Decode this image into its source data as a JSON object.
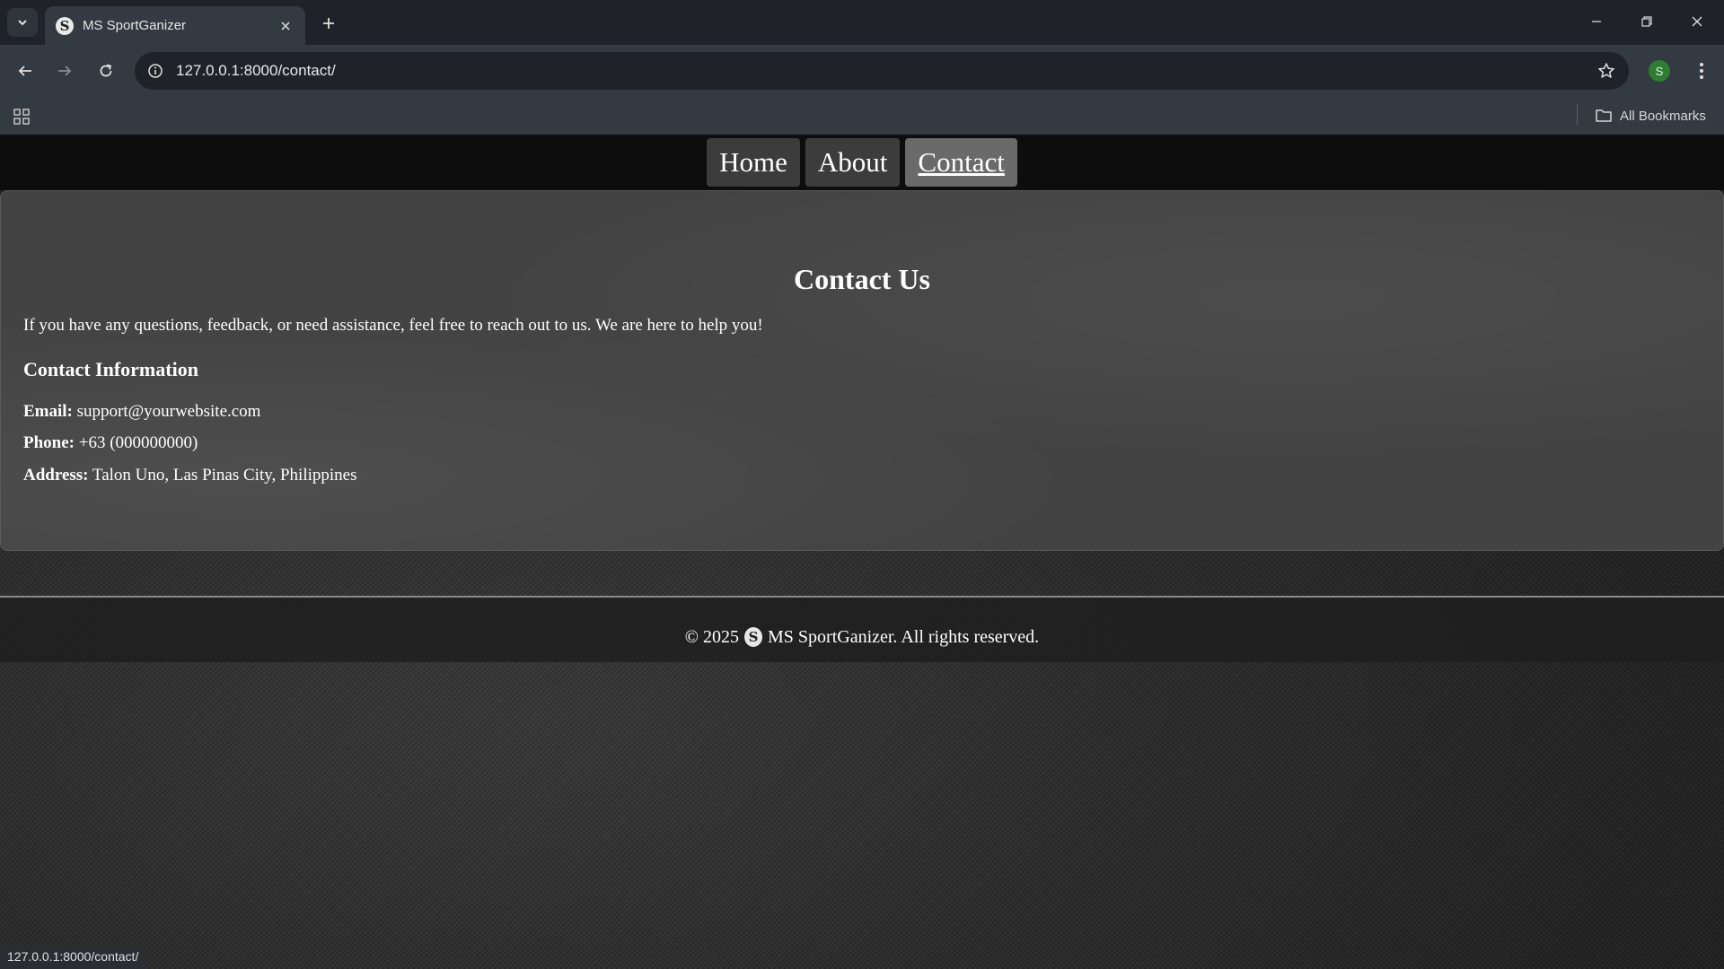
{
  "browser": {
    "tab_title": "MS SportGanizer",
    "url": "127.0.0.1:8000/contact/",
    "profile_initial": "S",
    "all_bookmarks_label": "All Bookmarks",
    "status_url": "127.0.0.1:8000/contact/",
    "tab_favicon_glyph": "S"
  },
  "nav": {
    "items": [
      {
        "label": "Home",
        "active": false
      },
      {
        "label": "About",
        "active": false
      },
      {
        "label": "Contact",
        "active": true
      }
    ]
  },
  "contact": {
    "title": "Contact Us",
    "intro": "If you have any questions, feedback, or need assistance, feel free to reach out to us. We are here to help you!",
    "section_title": "Contact Information",
    "email_label": "Email:",
    "email_value": "support@yourwebsite.com",
    "phone_label": "Phone:",
    "phone_value": "+63 (000000000)",
    "address_label": "Address:",
    "address_value": "Talon Uno, Las Pinas City, Philippines"
  },
  "footer": {
    "prefix": "© 2025",
    "logo_glyph": "S",
    "suffix": "MS SportGanizer. All rights reserved."
  }
}
